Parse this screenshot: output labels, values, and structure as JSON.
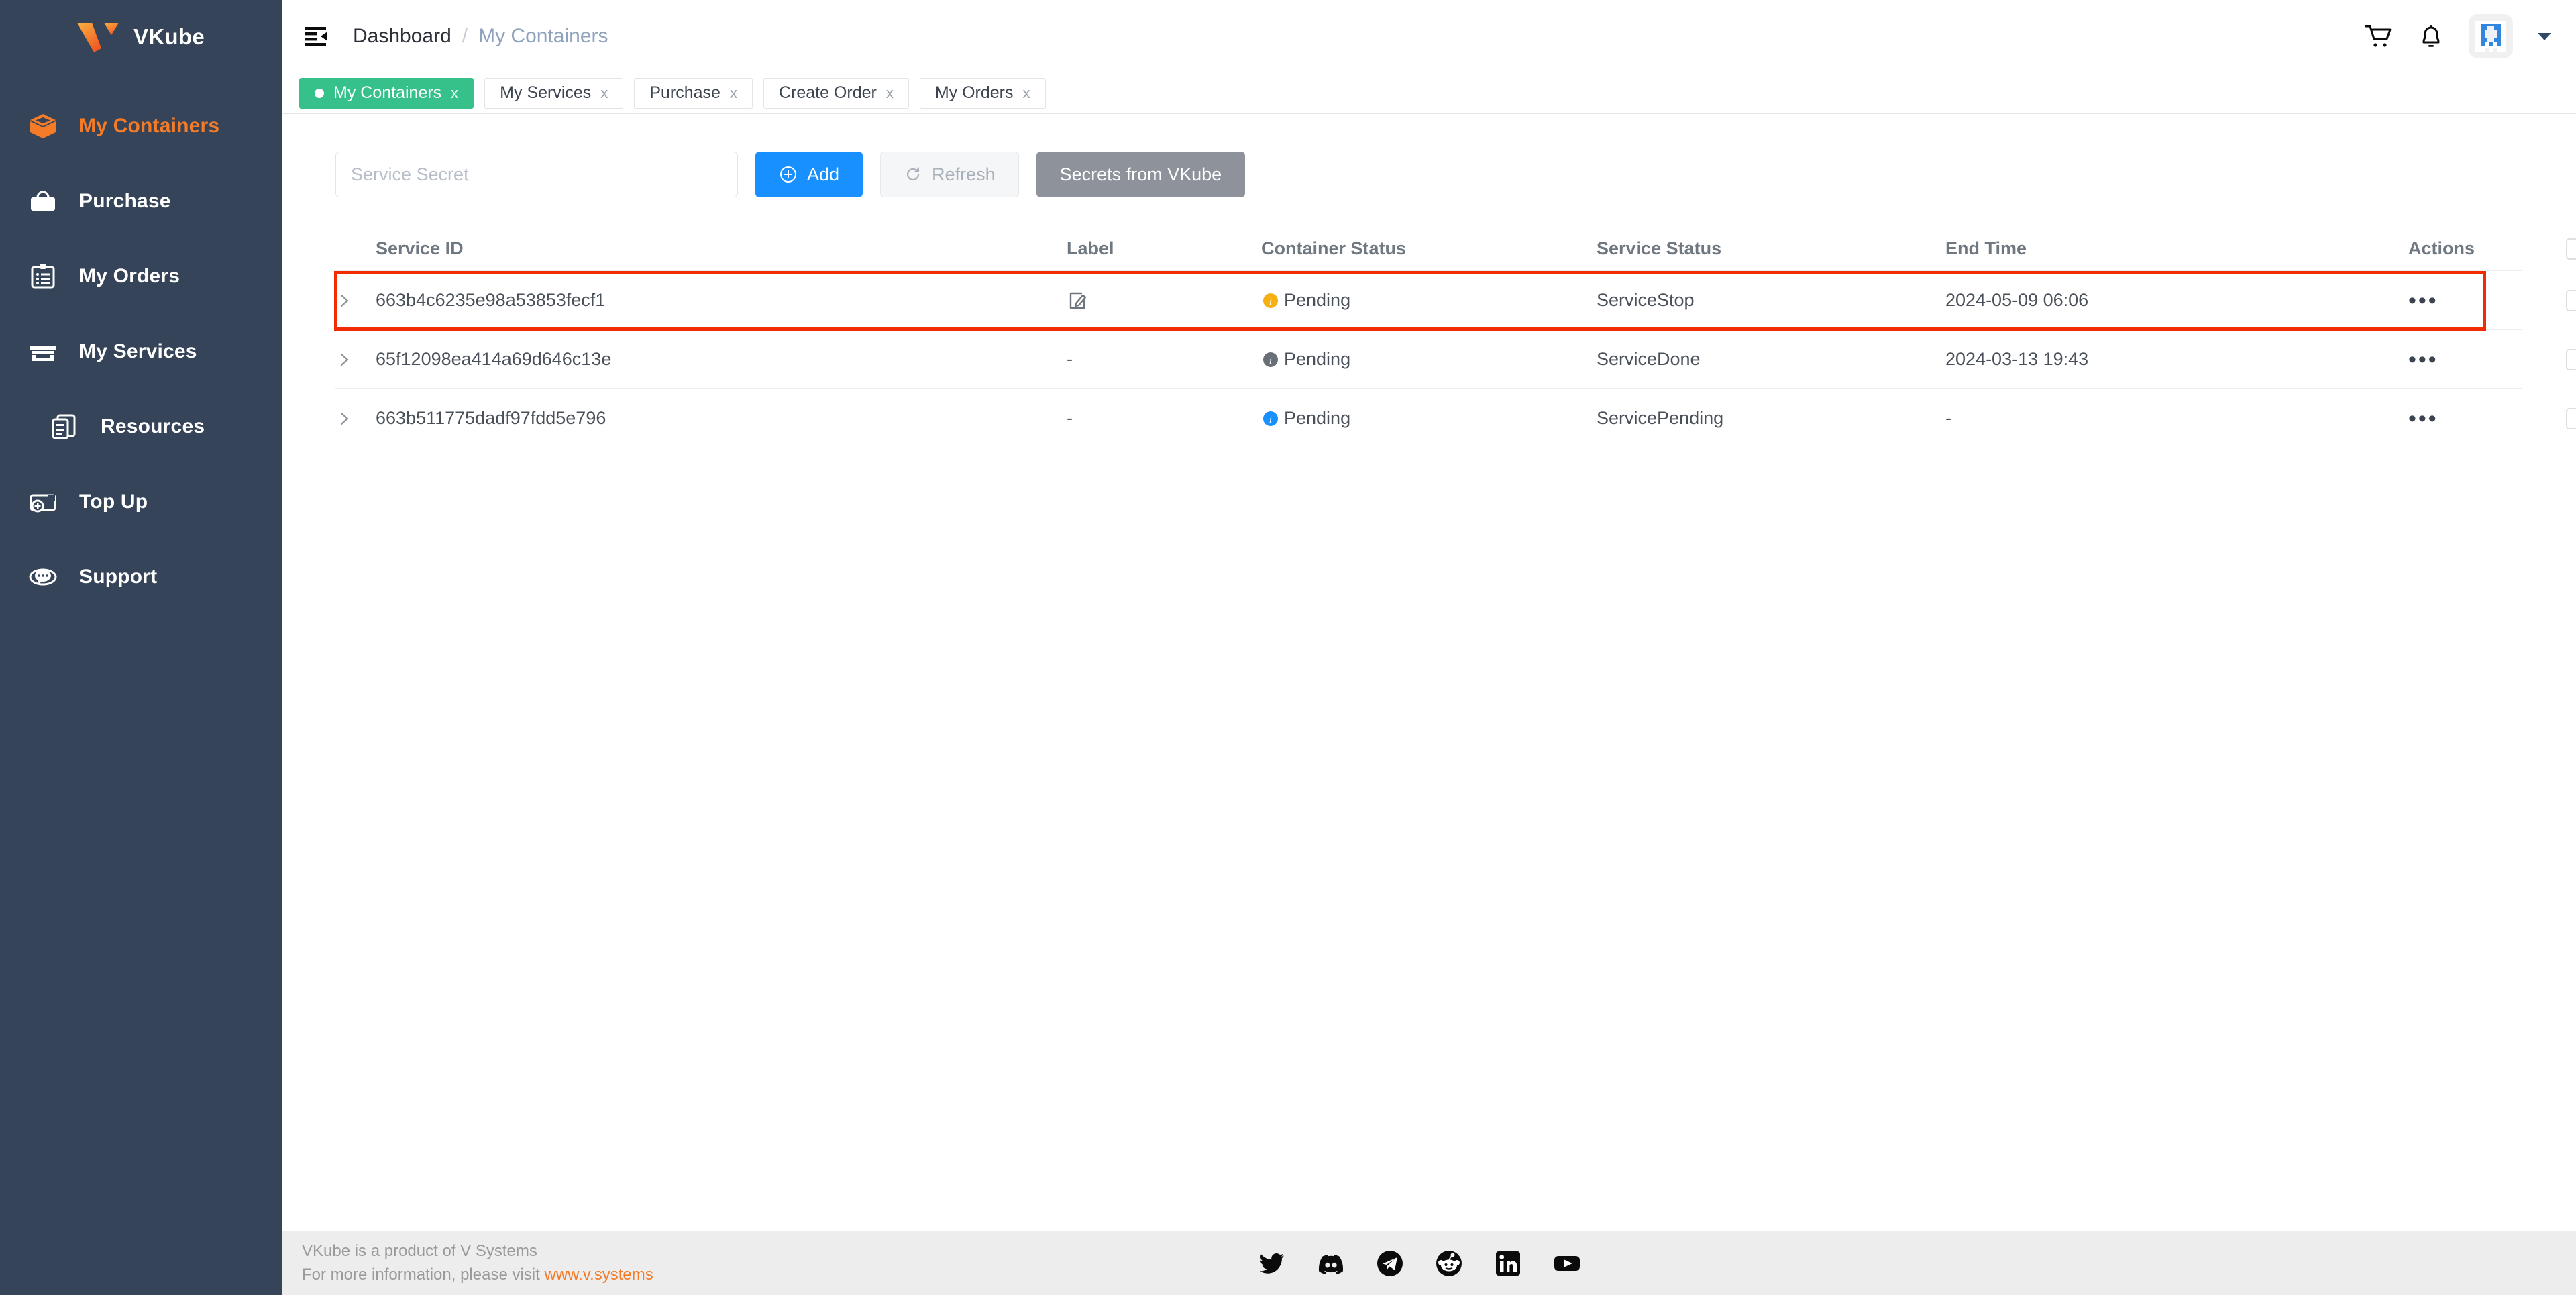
{
  "brand": {
    "name": "VKube",
    "logo_icon": "vkube-logo-icon"
  },
  "sidebar": {
    "items": [
      {
        "label": "My Containers",
        "icon": "box-icon",
        "active": true
      },
      {
        "label": "Purchase",
        "icon": "briefcase-icon",
        "active": false
      },
      {
        "label": "My Orders",
        "icon": "clipboard-icon",
        "active": false
      },
      {
        "label": "My Services",
        "icon": "storefront-icon",
        "active": false
      },
      {
        "label": "Resources",
        "icon": "documents-icon",
        "active": false
      },
      {
        "label": "Top Up",
        "icon": "wallet-icon",
        "active": false
      },
      {
        "label": "Support",
        "icon": "chat-icon",
        "active": false
      }
    ]
  },
  "header": {
    "fold_icon": "menu-fold-icon",
    "breadcrumb": {
      "root": "Dashboard",
      "separator": "/",
      "current": "My Containers"
    },
    "cart_icon": "shopping-cart-icon",
    "bell_icon": "bell-icon",
    "avatar_icon": "user-avatar-icon",
    "caret_icon": "chevron-down-icon"
  },
  "tabs": [
    {
      "label": "My Containers",
      "close": "x",
      "active": true
    },
    {
      "label": "My Services",
      "close": "x",
      "active": false
    },
    {
      "label": "Purchase",
      "close": "x",
      "active": false
    },
    {
      "label": "Create Order",
      "close": "x",
      "active": false
    },
    {
      "label": "My Orders",
      "close": "x",
      "active": false
    }
  ],
  "toolbar": {
    "search_placeholder": "Service Secret",
    "search_value": "",
    "add_label": "Add",
    "add_icon": "plus-circle-icon",
    "refresh_label": "Refresh",
    "refresh_icon": "refresh-icon",
    "secrets_label": "Secrets from VKube"
  },
  "table": {
    "columns": [
      "Service ID",
      "Label",
      "Container Status",
      "Service Status",
      "End Time",
      "Actions"
    ],
    "select_all_checked": false,
    "rows": [
      {
        "service_id": "663b4c6235e98a53853fecf1",
        "label": "",
        "label_icon": "edit-square-icon",
        "container_status": "Pending",
        "container_status_color": "#f5b014",
        "service_status": "ServiceStop",
        "end_time": "2024-05-09 06:06",
        "actions_icon": "more-horizontal-icon",
        "checked": false,
        "highlighted": true
      },
      {
        "service_id": "65f12098ea414a69d646c13e",
        "label": "-",
        "label_icon": "",
        "container_status": "Pending",
        "container_status_color": "#6a6f77",
        "service_status": "ServiceDone",
        "end_time": "2024-03-13 19:43",
        "actions_icon": "more-horizontal-icon",
        "checked": false,
        "highlighted": false
      },
      {
        "service_id": "663b511775dadf97fdd5e796",
        "label": "-",
        "label_icon": "",
        "container_status": "Pending",
        "container_status_color": "#1890ff",
        "service_status": "ServicePending",
        "end_time": "-",
        "actions_icon": "more-horizontal-icon",
        "checked": false,
        "highlighted": false
      }
    ]
  },
  "footer": {
    "line1": "VKube is a product of V Systems",
    "line2_prefix": "For more information, please visit ",
    "link_text": "www.v.systems",
    "socials": [
      {
        "name": "twitter-icon"
      },
      {
        "name": "discord-icon"
      },
      {
        "name": "telegram-icon"
      },
      {
        "name": "reddit-icon"
      },
      {
        "name": "linkedin-icon"
      },
      {
        "name": "youtube-icon"
      }
    ]
  },
  "colors": {
    "sidebar_bg": "#354458",
    "accent_orange": "#f47b28",
    "tab_active_green": "#36c08a",
    "primary_blue": "#1890ff",
    "grey_button": "#8e939b",
    "highlight_red": "#f22b00"
  }
}
